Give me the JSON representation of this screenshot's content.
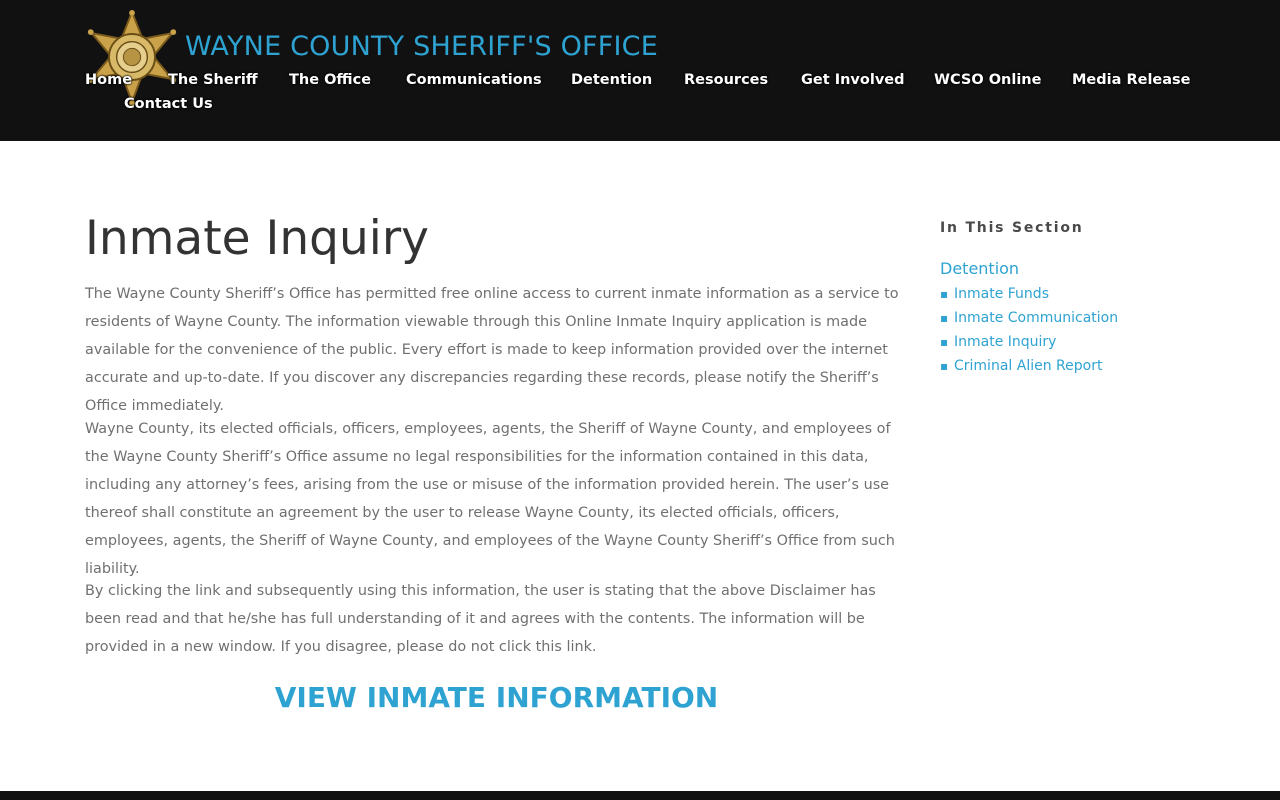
{
  "header": {
    "site_title": "WAYNE COUNTY SHERIFF'S OFFICE",
    "logo_icon": "sheriff-star-badge",
    "colors": {
      "background": "#111111",
      "title": "#2ea3d2",
      "nav_text": "#ffffff"
    }
  },
  "nav": {
    "items": [
      {
        "label": "Home"
      },
      {
        "label": "The Sheriff"
      },
      {
        "label": "The Office"
      },
      {
        "label": "Communications"
      },
      {
        "label": "Detention"
      },
      {
        "label": "Resources"
      },
      {
        "label": "Get Involved"
      },
      {
        "label": "WCSO Online"
      },
      {
        "label": "Media Release"
      },
      {
        "label": "Contact Us"
      }
    ]
  },
  "main": {
    "title": "Inmate Inquiry",
    "paragraphs": [
      "The Wayne County Sheriff’s Office has permitted free online access to current inmate information as a service to residents of Wayne County. The information viewable through this Online Inmate Inquiry application is made available for the convenience of the public. Every effort is made to keep information provided over the internet accurate and up-to-date. If you discover any discrepancies regarding these records, please notify the Sheriff’s Office immediately.",
      "Wayne County, its elected officials, officers, employees, agents, the Sheriff of Wayne County, and employees of the Wayne County Sheriff’s Office assume no legal responsibilities for the information contained in this data, including any attorney’s fees, arising from the use or misuse of the information provided herein. The user’s use thereof shall constitute an agreement by the user to release Wayne County, its elected officials, officers, employees, agents, the Sheriff of Wayne County, and employees of the Wayne County Sheriff’s Office from such liability.",
      "By clicking the link and subsequently using this information, the user is stating that the above Disclaimer has been read and that he/she has full understanding of it and agrees with the contents. The information will be provided in a new window. If you disagree, please do not click this link."
    ],
    "cta_label": "VIEW INMATE INFORMATION",
    "colors": {
      "title": "#333333",
      "body": "#707070",
      "link": "#2ea3d2"
    }
  },
  "sidebar": {
    "heading": "In This Section",
    "parent": "Detention",
    "links": [
      {
        "label": "Inmate Funds"
      },
      {
        "label": "Inmate Communication"
      },
      {
        "label": "Inmate Inquiry"
      },
      {
        "label": "Criminal Alien Report"
      }
    ],
    "bullet": "▪"
  }
}
